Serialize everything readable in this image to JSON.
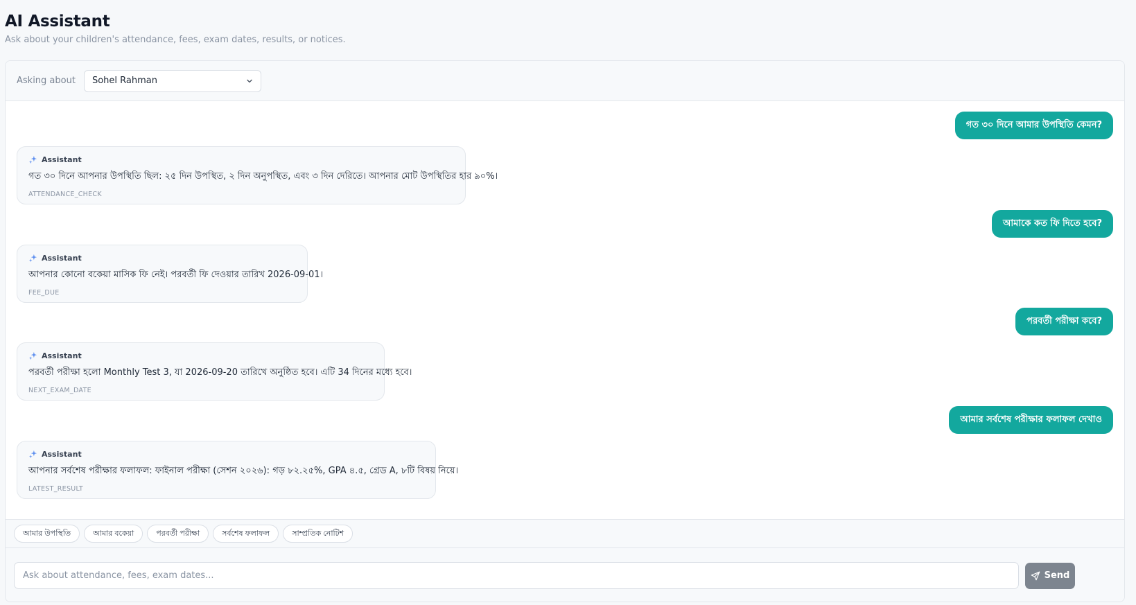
{
  "header": {
    "title": "AI Assistant",
    "subtitle": "Ask about your children's attendance, fees, exam dates, results, or notices."
  },
  "selector": {
    "label": "Asking about",
    "selected": "Sohel Rahman"
  },
  "messages": [
    {
      "role": "user",
      "text": "গত ৩০ দিনে আমার উপস্থিতি কেমন?"
    },
    {
      "role": "assistant",
      "author": "Assistant",
      "text": "গত ৩০ দিনে আপনার উপস্থিতি ছিল: ২৫ দিন উপস্থিত, ২ দিন অনুপস্থিত, এবং ৩ দিন দেরিতে। আপনার মোট উপস্থিতির হার ৯০%।",
      "tag": "ATTENDANCE_CHECK"
    },
    {
      "role": "user",
      "text": "আমাকে কত ফি দিতে হবে?"
    },
    {
      "role": "assistant",
      "author": "Assistant",
      "text": "আপনার কোনো বকেয়া মাসিক ফি নেই। পরবর্তী ফি দেওয়ার তারিখ 2026-09-01।",
      "tag": "FEE_DUE"
    },
    {
      "role": "user",
      "text": "পরবর্তী পরীক্ষা কবে?"
    },
    {
      "role": "assistant",
      "author": "Assistant",
      "text": "পরবর্তী পরীক্ষা হলো Monthly Test 3, যা 2026-09-20 তারিখে অনুষ্ঠিত হবে। এটি 34 দিনের মধ্যে হবে।",
      "tag": "NEXT_EXAM_DATE"
    },
    {
      "role": "user",
      "text": "আমার সর্বশেষ পরীক্ষার ফলাফল দেখাও"
    },
    {
      "role": "assistant",
      "author": "Assistant",
      "text": "আপনার সর্বশেষ পরীক্ষার ফলাফল: ফাইনাল পরীক্ষা (সেশন ২০২৬): গড় ৮২.২৫%, GPA ৪.৫, গ্রেড A, ৮টি বিষয় নিয়ে।",
      "tag": "LATEST_RESULT"
    }
  ],
  "quick_replies": [
    "আমার উপস্থিতি",
    "আমার বকেয়া",
    "পরবর্তী পরীক্ষা",
    "সর্বশেষ ফলাফল",
    "সাম্প্রতিক নোটিশ"
  ],
  "composer": {
    "placeholder": "Ask about attendance, fees, exam dates...",
    "send_label": "Send"
  },
  "colors": {
    "accent": "#13a89e",
    "send_button": "#7d858f"
  },
  "icons": {
    "assistant": "sparkle-icon",
    "select": "chevron-down-icon",
    "send": "send-icon"
  }
}
